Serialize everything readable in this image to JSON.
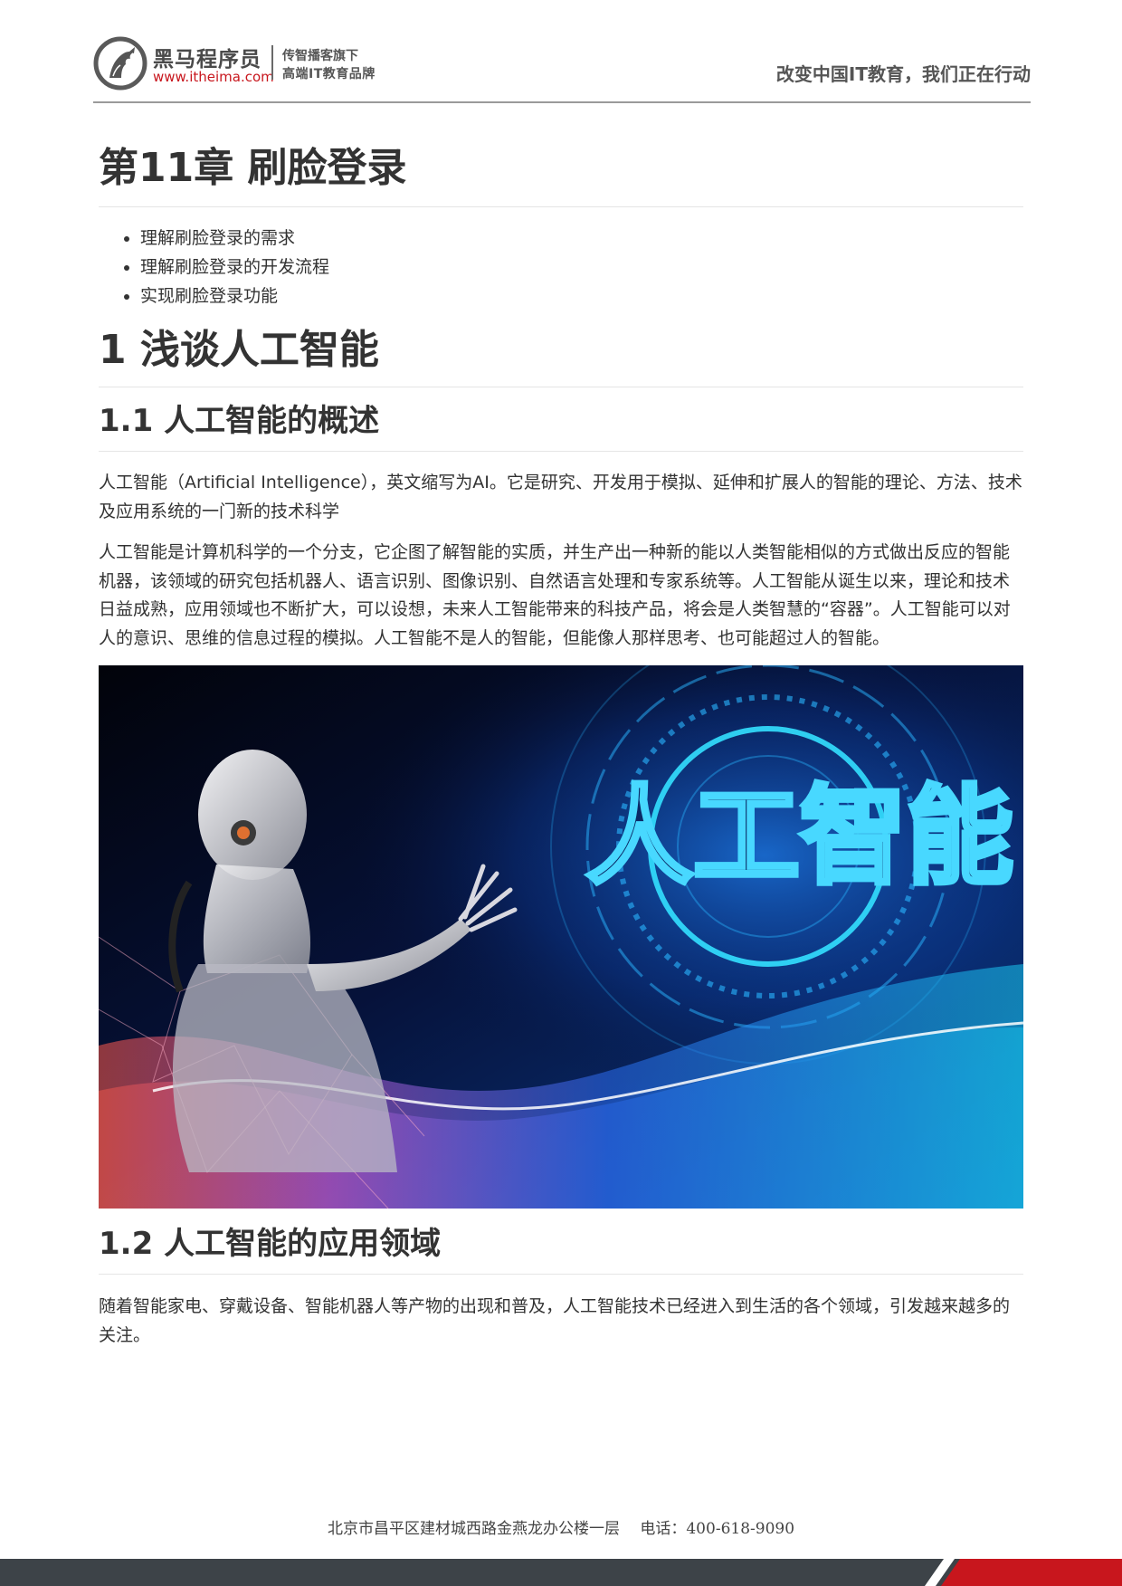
{
  "header": {
    "logo_name": "黑马程序员",
    "logo_url": "www.itheima.com",
    "tagline_1": "传智播客旗下",
    "tagline_2": "高端IT教育品牌",
    "slogan": "改变中国IT教育，我们正在行动",
    "brand_red": "#c8161d"
  },
  "doc": {
    "chapter_title": "第11章 刷脸登录",
    "goals": [
      "理解刷脸登录的需求",
      "理解刷脸登录的开发流程",
      "实现刷脸登录功能"
    ],
    "section_1_title": "1 浅谈人工智能",
    "sub_1_1_title": "1.1 人工智能的概述",
    "para_1": "人工智能（Artificial Intelligence），英文缩写为AI。它是研究、开发用于模拟、延伸和扩展人的智能的理论、方法、技术及应用系统的一门新的技术科学",
    "para_2": "人工智能是计算机科学的一个分支，它企图了解智能的实质，并生产出一种新的能以人类智能相似的方式做出反应的智能机器，该领域的研究包括机器人、语言识别、图像识别、自然语言处理和专家系统等。人工智能从诞生以来，理论和技术日益成熟，应用领域也不断扩大，可以设想，未来人工智能带来的科技产品，将会是人类智慧的“容器”。人工智能可以对人的意识、思维的信息过程的模拟。人工智能不是人的智能，但能像人那样思考、也可能超过人的智能。",
    "image_caption_text": "人工智能",
    "sub_1_2_title": "1.2 人工智能的应用领域",
    "para_3": "随着智能家电、穿戴设备、智能机器人等产物的出现和普及，人工智能技术已经进入到生活的各个领域，引发越来越多的关注。"
  },
  "footer": {
    "address": "北京市昌平区建材城西路金燕龙办公楼一层　 电话：400-618-9090",
    "bar_color": "#3d4348",
    "accent_color": "#c8161d"
  }
}
